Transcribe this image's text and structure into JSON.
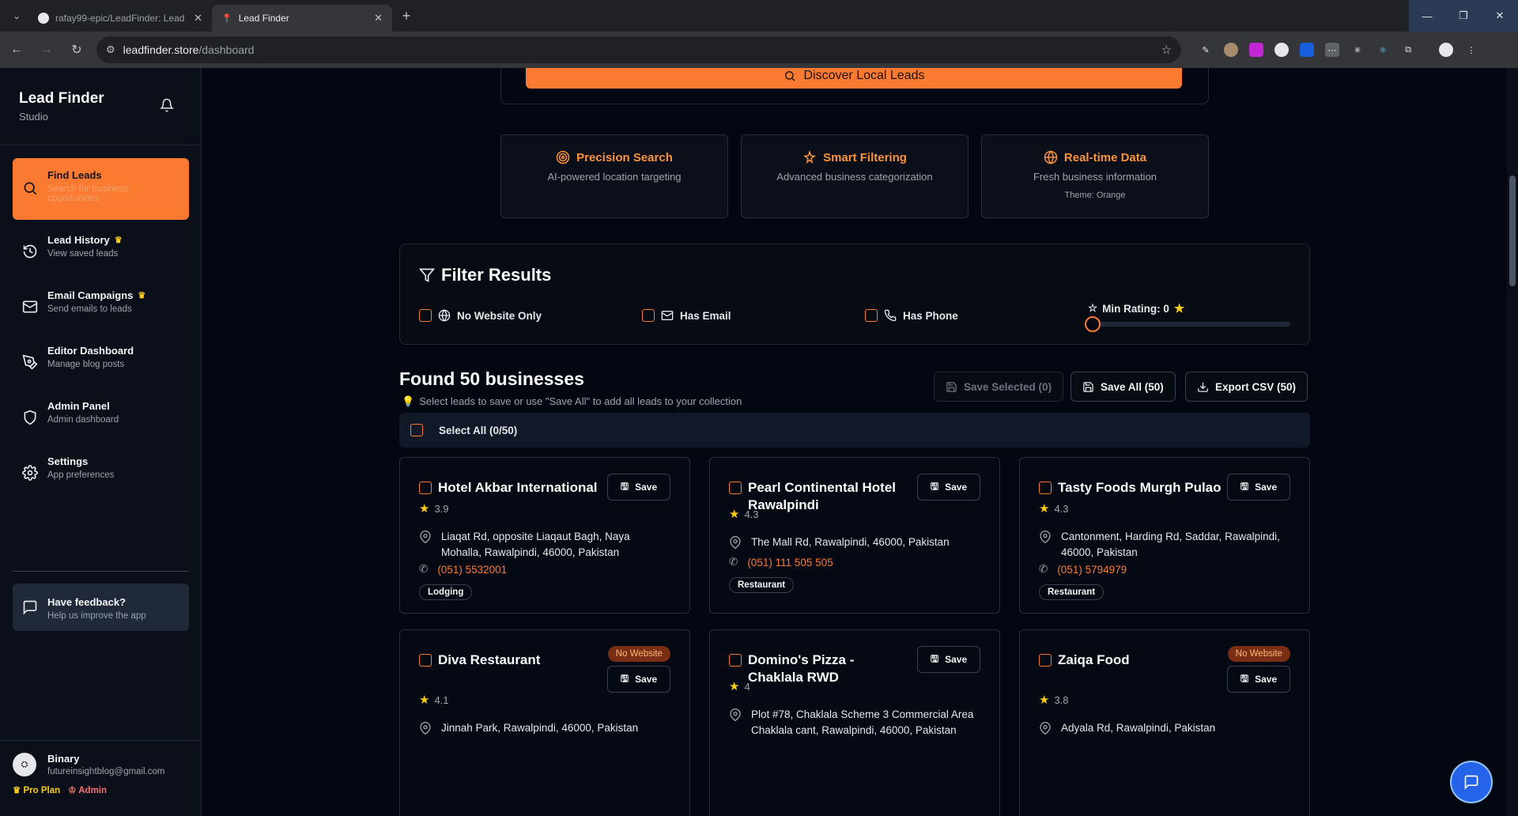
{
  "browser": {
    "tabs": [
      {
        "title": "rafay99-epic/LeadFinder: Lead",
        "icon": "github-icon"
      },
      {
        "title": "Lead Finder",
        "icon": "pin-icon"
      }
    ],
    "url_domain": "leadfinder.store",
    "url_path": "/dashboard"
  },
  "sidebar": {
    "brand_title": "Lead Finder",
    "brand_sub": "Studio",
    "items": [
      {
        "label": "Find Leads",
        "desc": "Search for business opportunities",
        "icon": "search-icon",
        "active": true
      },
      {
        "label": "Lead History",
        "desc": "View saved leads",
        "icon": "history-icon",
        "crown": true
      },
      {
        "label": "Email Campaigns",
        "desc": "Send emails to leads",
        "icon": "mail-icon",
        "crown": true
      },
      {
        "label": "Editor Dashboard",
        "desc": "Manage blog posts",
        "icon": "pen-icon"
      },
      {
        "label": "Admin Panel",
        "desc": "Admin dashboard",
        "icon": "shield-icon"
      },
      {
        "label": "Settings",
        "desc": "App preferences",
        "icon": "gear-icon"
      }
    ],
    "feedback": {
      "label": "Have feedback?",
      "desc": "Help us improve the app"
    },
    "user": {
      "name": "Binary",
      "email": "futureinsightblog@gmail.com",
      "plan": "Pro Plan",
      "role": "Admin"
    }
  },
  "search": {
    "discover_label": "Discover Local Leads"
  },
  "features": [
    {
      "title": "Precision Search",
      "desc": "AI-powered location targeting",
      "icon": "target-icon"
    },
    {
      "title": "Smart Filtering",
      "desc": "Advanced business categorization",
      "icon": "sparkle-icon"
    },
    {
      "title": "Real-time Data",
      "desc": "Fresh business information",
      "extra": "Theme: Orange",
      "icon": "globe-icon"
    }
  ],
  "filters": {
    "title": "Filter Results",
    "no_website": "No Website Only",
    "has_email": "Has Email",
    "has_phone": "Has Phone",
    "min_rating_label": "Min Rating: 0",
    "min_rating_value": 0
  },
  "results": {
    "title": "Found 50 businesses",
    "hint": "Select leads to save or use \"Save All\" to add all leads to your collection",
    "save_selected": "Save Selected (0)",
    "save_all": "Save All (50)",
    "export_csv": "Export CSV (50)",
    "select_all": "Select All (0/50)",
    "save_label": "Save",
    "no_website_badge": "No Website",
    "cards": [
      {
        "name": "Hotel Akbar International",
        "rating": "3.9",
        "address": "Liaqat Rd, opposite Liaqaut Bagh, Naya Mohalla, Rawalpindi, 46000, Pakistan",
        "phone": "(051) 5532001",
        "tag": "Lodging"
      },
      {
        "name": "Pearl Continental Hotel Rawalpindi",
        "rating": "4.3",
        "address": "The Mall Rd, Rawalpindi, 46000, Pakistan",
        "phone": "(051) 111 505 505",
        "tag": "Restaurant"
      },
      {
        "name": "Tasty Foods Murgh Pulao",
        "rating": "4.3",
        "address": "Cantonment, Harding Rd, Saddar, Rawalpindi, 46000, Pakistan",
        "phone": "(051) 5794979",
        "tag": "Restaurant"
      },
      {
        "name": "Diva Restaurant",
        "rating": "4.1",
        "address": "Jinnah Park, Rawalpindi, 46000, Pakistan",
        "no_website": true
      },
      {
        "name": "Domino's Pizza - Chaklala RWD",
        "rating": "4",
        "address": "Plot #78, Chaklala Scheme 3 Commercial Area Chaklala cant, Rawalpindi, 46000, Pakistan"
      },
      {
        "name": "Zaiqa Food",
        "rating": "3.8",
        "address": "Adyala Rd, Rawalpindi, Pakistan",
        "no_website": true
      }
    ]
  },
  "colors": {
    "accent": "#fb7a32",
    "background": "#030712",
    "card_border": "#2a2f3a"
  }
}
